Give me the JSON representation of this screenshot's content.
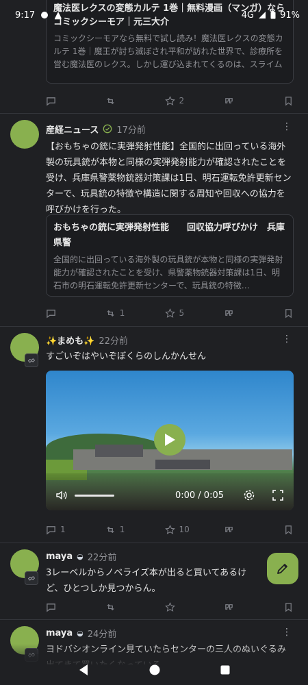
{
  "status_bar": {
    "time": "9:17",
    "network": "4G",
    "battery": "91%"
  },
  "top_card": {
    "title": "魔法医レクスの変態カルテ 1巻｜無料漫画（マンガ）ならコミックシーモア｜元三大介",
    "desc": "コミックシーモアなら無料で試し読み！魔法医レクスの変態カルテ 1巻｜魔王が討ち滅ぼされ平和が訪れた世界で、診療所を営む魔法医のレクス。しかし運び込まれてくるのは、スライムで××したりマンイーターに××をつっこんだりする、世界…",
    "favorites": "2"
  },
  "posts": [
    {
      "author": "産経ニュース",
      "time": "17分前",
      "text": "【おもちゃの銃に実弾発射性能】全国的に出回っている海外製の玩具銃が本物と同様の実弾発射能力が確認されたことを受け、兵庫県警薬物銃器対策課は1日、明石運転免許更新センターで、玩具銃の特徴や構造に関する周知や回収への協力を呼びかけを行った。",
      "card_title": "おもちゃの銃に実弾発射性能　　回収協力呼びかけ　兵庫県警",
      "card_desc": "全国的に出回っている海外製の玩具銃が本物と同様の実弾発射能力が確認されたことを受け、県警薬物銃器対策課は1日、明石市の明石運転免許更新センターで、玩具銃の特徴…",
      "boosts": "1",
      "favorites": "5"
    },
    {
      "author": "✨まめも✨",
      "time": "22分前",
      "text": "すごいぞはやいぞぼくらのしんかんせん",
      "video_time": "0:00 / 0:05",
      "replies": "1",
      "boosts": "1",
      "favorites": "10"
    },
    {
      "author": "maya",
      "time": "22分前",
      "text": "3レーベルからノベライズ本が出ると買いてあるけど、ひとつしか見つからん。"
    },
    {
      "author": "maya",
      "time": "24分前",
      "text": "ヨドバシオンライン見ていたらセンターの三人のぬいぐるみ出てきて買いたくなっている。"
    }
  ],
  "colors": {
    "accent": "#89b04f",
    "background": "#1f2023",
    "muted": "#8f9095"
  }
}
